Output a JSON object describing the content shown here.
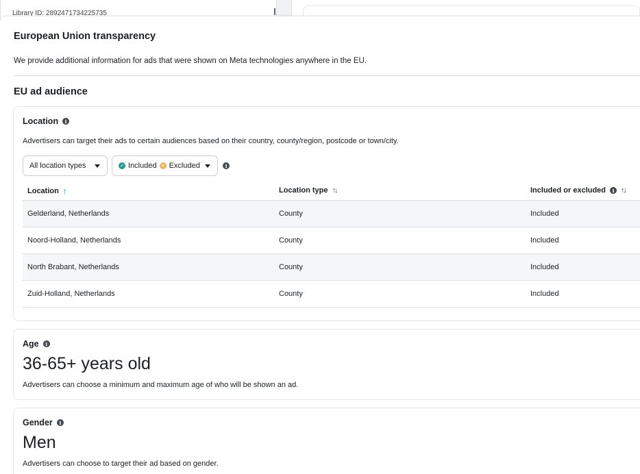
{
  "background": {
    "library_id": "Library ID: 2892471734225735"
  },
  "eu": {
    "title": "European Union transparency",
    "description": "We provide additional information for ads that were shown on Meta technologies anywhere in the EU."
  },
  "audience": {
    "title": "EU ad audience"
  },
  "location": {
    "title": "Location",
    "description": "Advertisers can target their ads to certain audiences based on their country, county/region, postcode or town/city.",
    "filter_type_label": "All location types",
    "filter_included_label": "Included",
    "filter_excluded_label": "Excluded",
    "columns": [
      "Location",
      "Location type",
      "Included or excluded"
    ],
    "rows": [
      {
        "location": "Gelderland, Netherlands",
        "type": "County",
        "status": "Included"
      },
      {
        "location": "Noord-Holland, Netherlands",
        "type": "County",
        "status": "Included"
      },
      {
        "location": "North Brabant, Netherlands",
        "type": "County",
        "status": "Included"
      },
      {
        "location": "Zuid-Holland, Netherlands",
        "type": "County",
        "status": "Included"
      }
    ]
  },
  "age": {
    "title": "Age",
    "value": "36-65+ years old",
    "description": "Advertisers can choose a minimum and maximum age of who will be shown an ad."
  },
  "gender": {
    "title": "Gender",
    "value": "Men",
    "description": "Advertisers can choose to target their ad based on gender."
  },
  "icons": {
    "info": "info-icon",
    "sort_asc": "arrow-up-icon",
    "sort": "sort-icon",
    "caret": "caret-down-icon",
    "included": "check-circle-icon",
    "excluded": "x-circle-icon"
  },
  "colors": {
    "accent": "#1877f2",
    "included": "#2a9d8f",
    "excluded": "#f0b25a"
  }
}
